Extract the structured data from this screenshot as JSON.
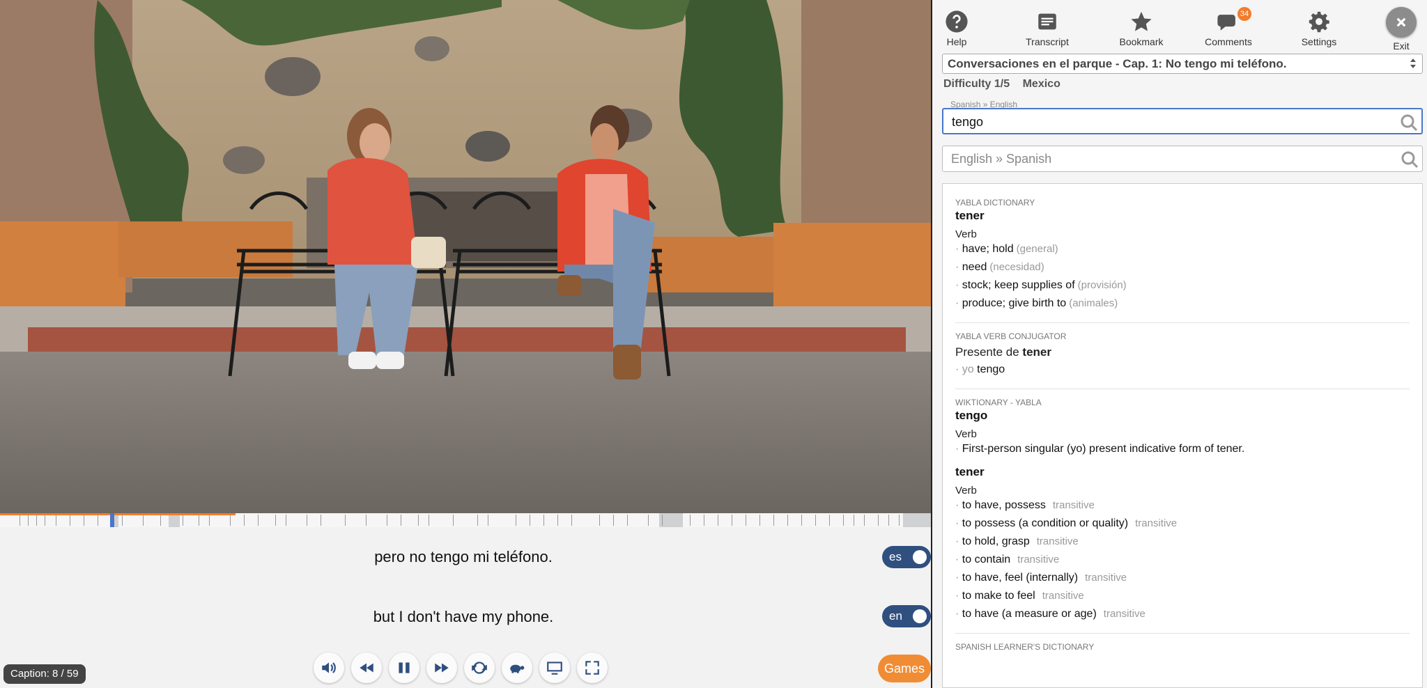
{
  "toolbar": {
    "help": "Help",
    "transcript": "Transcript",
    "bookmark": "Bookmark",
    "comments": "Comments",
    "comments_count": "34",
    "settings": "Settings",
    "exit": "Exit"
  },
  "video_select": "Conversaciones en el parque - Cap. 1: No tengo mi teléfono.",
  "meta": {
    "difficulty": "Difficulty 1/5",
    "country": "Mexico"
  },
  "search": {
    "es_label": "Spanish » English",
    "es_value": "tengo",
    "en_placeholder": "English » Spanish"
  },
  "captions": {
    "es": "pero no tengo mi teléfono.",
    "en": "but I don't have my phone.",
    "es_toggle": "es",
    "en_toggle": "en",
    "counter": "Caption: 8 / 59"
  },
  "games_label": "Games",
  "dictionary": {
    "source": "YABLA DICTIONARY",
    "headword": "tener",
    "pos": "Verb",
    "defs": [
      {
        "text": "have; hold",
        "note": "(general)"
      },
      {
        "text": "need",
        "note": "(necesidad)"
      },
      {
        "text": "stock; keep supplies of",
        "note": "(provisión)"
      },
      {
        "text": "produce; give birth to",
        "note": "(animales)"
      }
    ]
  },
  "conjugator": {
    "source": "YABLA VERB CONJUGATOR",
    "line_prefix": "Presente de",
    "line_verb": "tener",
    "pronoun": "yo",
    "form": "tengo"
  },
  "wiktionary": {
    "source": "WIKTIONARY - YABLA",
    "entry1": {
      "headword": "tengo",
      "pos": "Verb",
      "def": "First-person singular (yo) present indicative form of tener."
    },
    "entry2": {
      "headword": "tener",
      "pos": "Verb",
      "defs": [
        {
          "text": "to have, possess",
          "tag": "transitive"
        },
        {
          "text": "to possess (a condition or quality)",
          "tag": "transitive"
        },
        {
          "text": "to hold, grasp",
          "tag": "transitive"
        },
        {
          "text": "to contain",
          "tag": "transitive"
        },
        {
          "text": "to have, feel (internally)",
          "tag": "transitive"
        },
        {
          "text": "to make to feel",
          "tag": "transitive"
        },
        {
          "text": "to have (a measure or age)",
          "tag": "transitive"
        }
      ]
    }
  },
  "learners": {
    "source": "SPANISH LEARNER'S DICTIONARY"
  },
  "controls": [
    "volume-icon",
    "rewind-icon",
    "pause-icon",
    "forward-icon",
    "loop-icon",
    "slow-turtle-icon",
    "screen-icon",
    "fullscreen-icon"
  ],
  "colors": {
    "accent": "#2f4f7f",
    "orange": "#f08c34",
    "badge": "#f47c2b"
  }
}
